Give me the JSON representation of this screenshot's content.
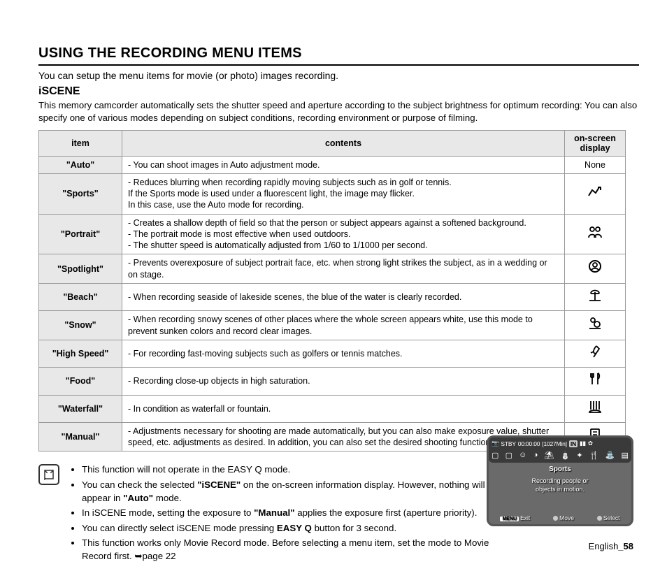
{
  "heading": "USING THE RECORDING MENU ITEMS",
  "intro": "You can setup the menu items for movie (or photo) images recording.",
  "section_i": "i",
  "section_rest": "SCENE",
  "section_desc": "This memory camcorder automatically sets the shutter speed and aperture according to the subject brightness for optimum recording: You can also specify one of various modes depending on subject conditions, recording environment or purpose of filming.",
  "th_item": "item",
  "th_contents": "contents",
  "th_display_l1": "on-screen",
  "th_display_l2": "display",
  "rows": [
    {
      "item": "\"Auto\"",
      "contents": "- You can shoot images in Auto adjustment mode.",
      "disp": "None",
      "dispIsText": true
    },
    {
      "item": "\"Sports\"",
      "contents": "- Reduces blurring when recording rapidly moving subjects such as in golf or tennis.\n  If the Sports mode is used under a fluorescent light, the image may flicker.\n  In this case, use the Auto mode for recording.",
      "icon": "sports"
    },
    {
      "item": "\"Portrait\"",
      "contents": "- Creates a shallow depth of field so that the person or subject appears against a softened background.\n- The portrait mode is most effective when used outdoors.\n- The shutter speed is automatically adjusted from 1/60 to 1/1000 per second.",
      "icon": "portrait"
    },
    {
      "item": "\"Spotlight\"",
      "contents": "- Prevents overexposure of subject portrait face, etc. when strong light strikes the subject, as in a wedding or on stage.",
      "icon": "spotlight"
    },
    {
      "item": "\"Beach\"",
      "contents": "- When recording seaside of lakeside scenes, the blue of the water is clearly recorded.",
      "icon": "beach"
    },
    {
      "item": "\"Snow\"",
      "contents": "- When recording snowy scenes of other places where the whole screen appears white, use this mode to prevent sunken colors and record clear images.",
      "icon": "snow"
    },
    {
      "item": "\"High Speed\"",
      "contents": "- For recording fast-moving subjects such as golfers or tennis matches.",
      "icon": "highspeed"
    },
    {
      "item": "\"Food\"",
      "contents": "- Recording close-up objects in high saturation.",
      "icon": "food"
    },
    {
      "item": "\"Waterfall\"",
      "contents": "- In condition as waterfall or fountain.",
      "icon": "waterfall"
    },
    {
      "item": "\"Manual\"",
      "contents": "- Adjustments necessary for shooting are made automatically, but you can also make exposure value, shutter speed, etc. adjustments as desired. In addition, you can also set the desired shooting functions using menus.",
      "icon": "manual"
    }
  ],
  "notes": {
    "n1": "This function will not operate in the EASY Q mode.",
    "n2a": "You can check the selected ",
    "n2b": "\"iSCENE\"",
    "n2c": " on the on-screen information display. However, nothing will appear in ",
    "n2d": "\"Auto\"",
    "n2e": " mode.",
    "n3a": "In iSCENE mode, setting the exposure to ",
    "n3b": "\"Manual\"",
    "n3c": " applies the exposure first (aperture priority).",
    "n4a": "You can directly select iSCENE mode pressing ",
    "n4b": "EASY Q",
    "n4c": " button for 3 second.",
    "n5": "This function works only Movie Record mode. Before selecting a menu item, set the mode to Movie Record first. ➥page 22"
  },
  "lcd": {
    "stby": "STBY",
    "time": "00:00:00",
    "remain": "[1027Min]",
    "in": "IN",
    "title": "Sports",
    "sub1": "Recording people or",
    "sub2": "objects in motion.",
    "menu": "MENU",
    "exit": "Exit",
    "move": "Move",
    "select": "Select"
  },
  "footer_lang": "English",
  "footer_page": "_58"
}
